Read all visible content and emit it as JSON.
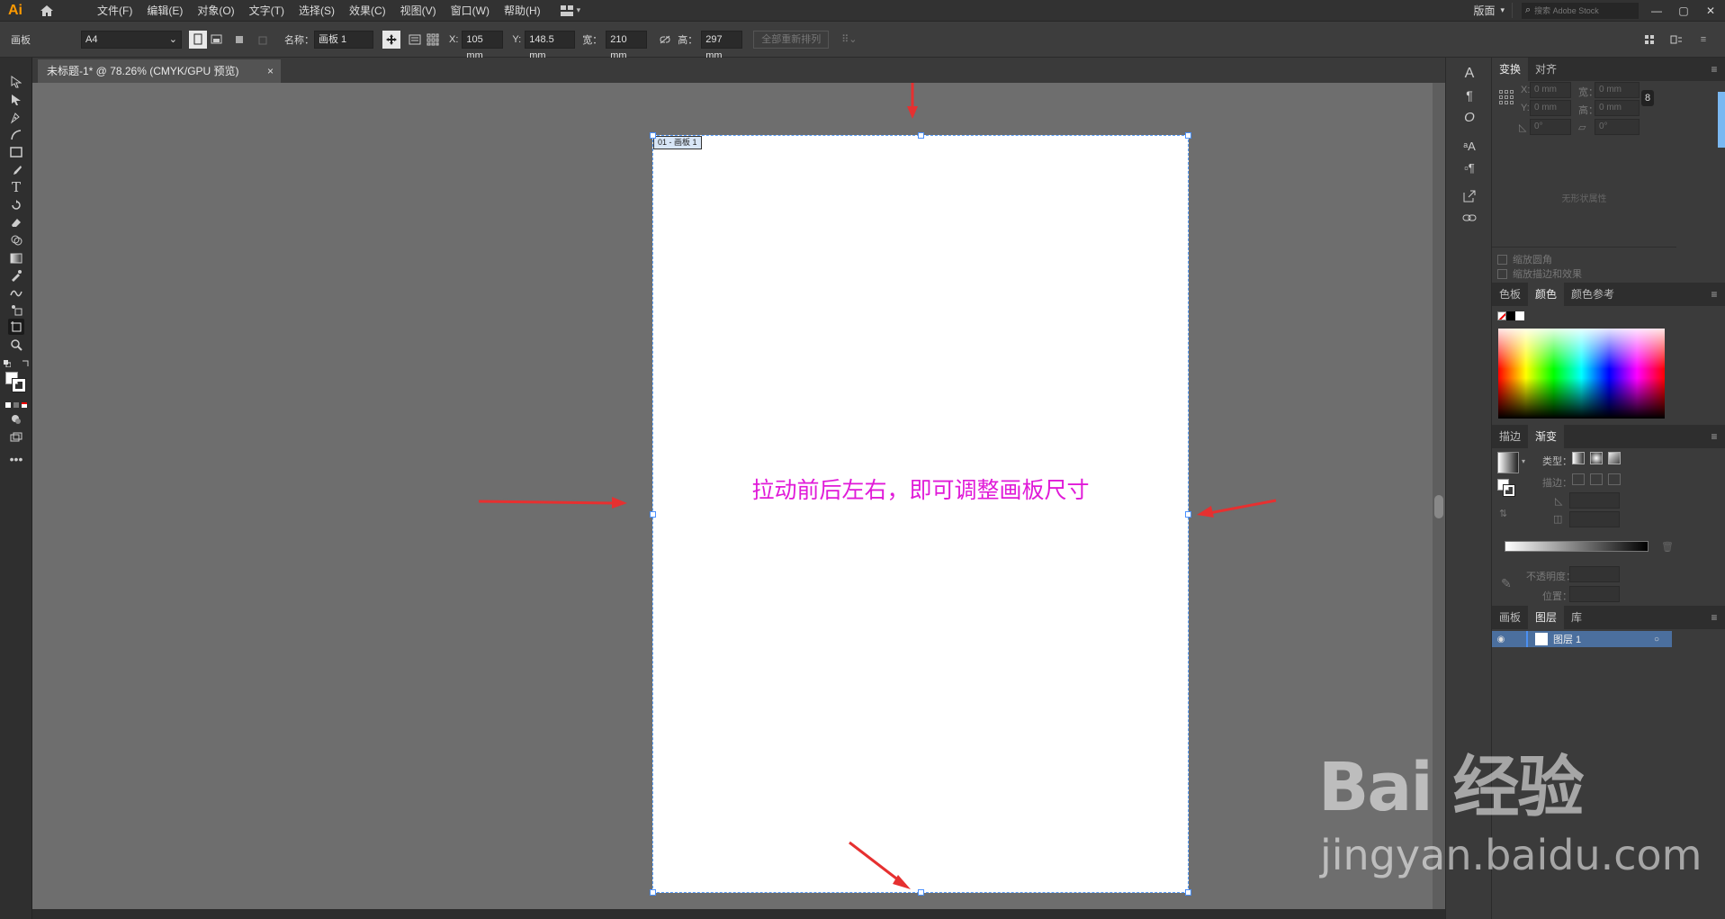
{
  "app": {
    "logo": "Ai"
  },
  "menubar": {
    "items": [
      "文件(F)",
      "编辑(E)",
      "对象(O)",
      "文字(T)",
      "选择(S)",
      "效果(C)",
      "视图(V)",
      "窗口(W)",
      "帮助(H)"
    ],
    "workspace": "版面",
    "search_placeholder": "搜索 Adobe Stock"
  },
  "controlbar": {
    "mode_label": "画板",
    "preset": "A4",
    "name_label": "名称：",
    "name_value": "画板 1",
    "x_label": "X:",
    "x_value": "105 mm",
    "y_label": "Y:",
    "y_value": "148.5 mm",
    "width_label": "宽：",
    "width_value": "210 mm",
    "height_label": "高：",
    "height_value": "297 mm",
    "rearrange_label": "全部重新排列"
  },
  "document": {
    "tab_title": "未标题-1* @ 78.26% (CMYK/GPU 预览)",
    "close_glyph": "×",
    "artboard_label": "01 - 画板 1",
    "annotation": "拉动前后左右，即可调整画板尺寸"
  },
  "transform_panel": {
    "tabs": [
      "变换",
      "对齐"
    ],
    "x_label": "X:",
    "x_value": "0 mm",
    "y_label": "Y:",
    "y_value": "0 mm",
    "w_label": "宽：",
    "w_value": "0 mm",
    "h_label": "高：",
    "h_value": "0 mm",
    "angle_value": "0°",
    "shear_value": "0°",
    "no_shape": "无形状属性",
    "scale_corners": "缩放圆角",
    "scale_strokes": "缩放描边和效果"
  },
  "color_panel": {
    "tabs": [
      "色板",
      "颜色",
      "颜色参考"
    ]
  },
  "gradient_panel": {
    "tabs": [
      "描边",
      "渐变"
    ],
    "type_label": "类型：",
    "stroke_label": "描边：",
    "opacity_label": "不透明度：",
    "position_label": "位置："
  },
  "layers_panel": {
    "tabs": [
      "画板",
      "图层",
      "库"
    ],
    "layer_name": "图层 1"
  },
  "watermark": {
    "brand": "Bai 经验",
    "url": "jingyan.baidu.com"
  },
  "colors": {
    "accent": "#e01ad8",
    "selection": "#5aa0ff",
    "arrow": "#e63030"
  }
}
